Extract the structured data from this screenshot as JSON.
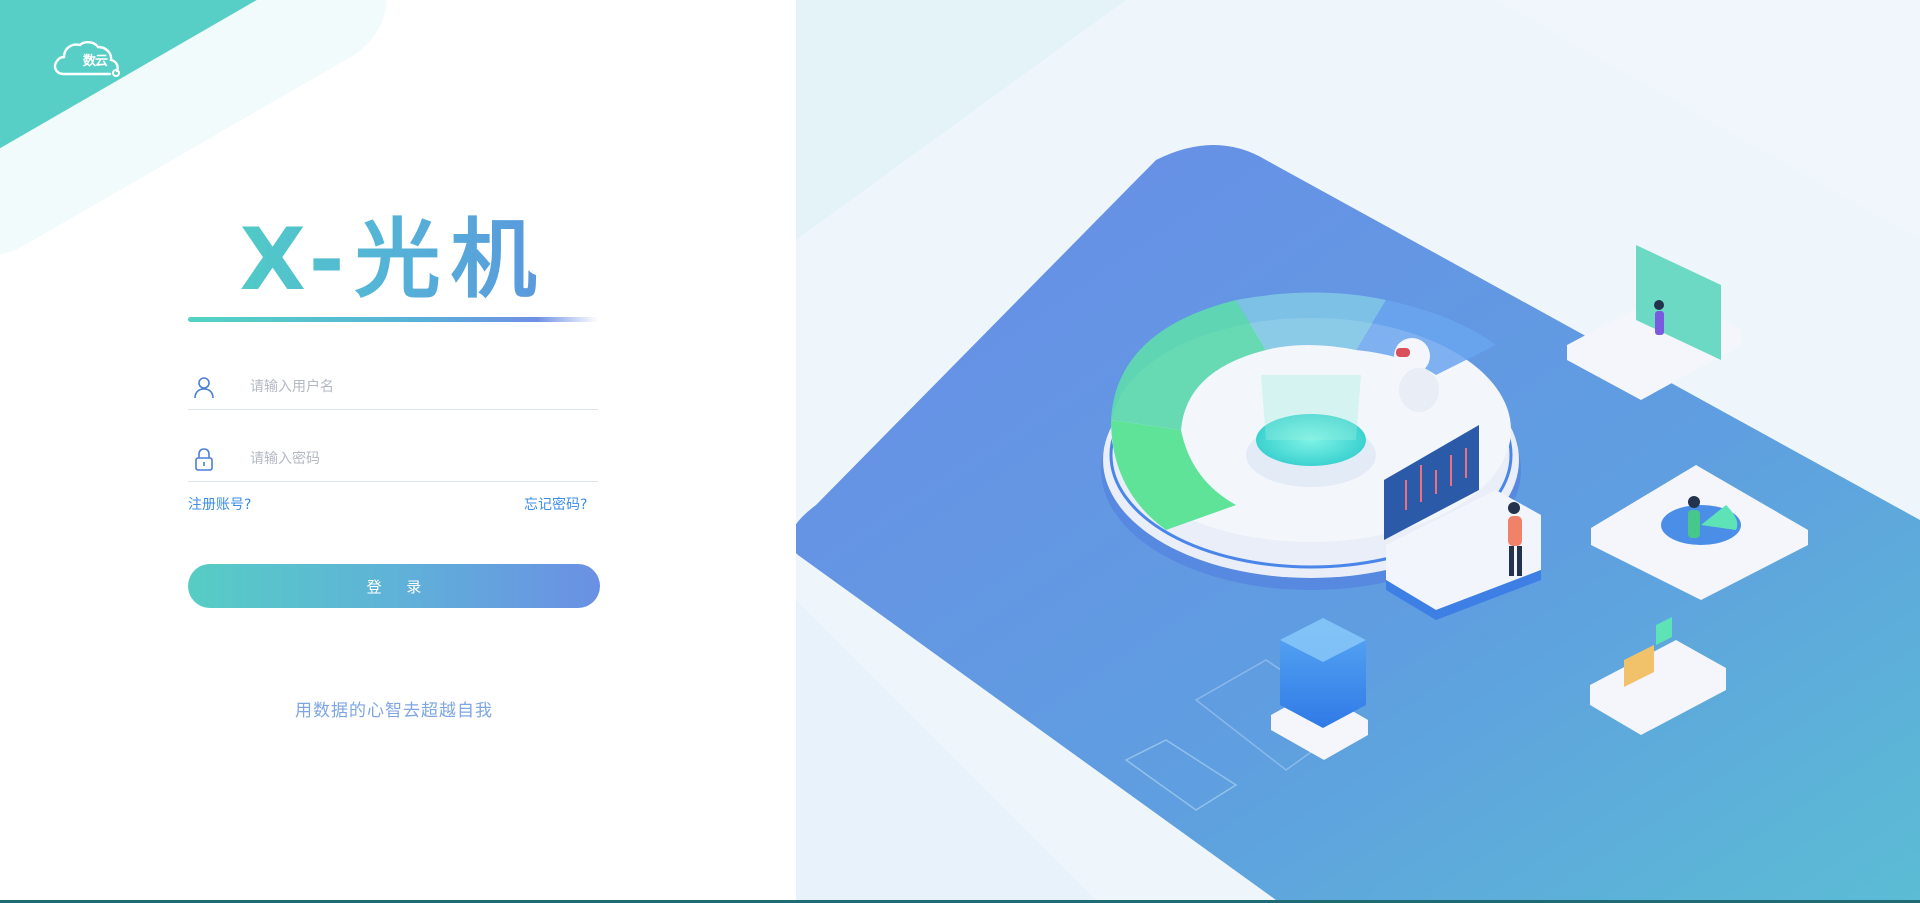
{
  "brand": {
    "logo_text": "数云"
  },
  "login": {
    "title": "X-光机",
    "username_placeholder": "请输入用户名",
    "username_value": "",
    "password_placeholder": "请输入密码",
    "password_value": "",
    "register_link": "注册账号?",
    "forgot_link": "忘记密码?",
    "login_button": "登 录",
    "slogan": "用数据的心智去超越自我"
  },
  "icons": {
    "logo": "cloud-icon",
    "username": "user-icon",
    "password": "lock-icon"
  },
  "colors": {
    "accent_teal": "#58cfc6",
    "accent_blue": "#6a90e4",
    "link_blue": "#3d8ee8",
    "slogan_blue": "#7ea6e2",
    "illustration_platform": "#6490e6"
  }
}
